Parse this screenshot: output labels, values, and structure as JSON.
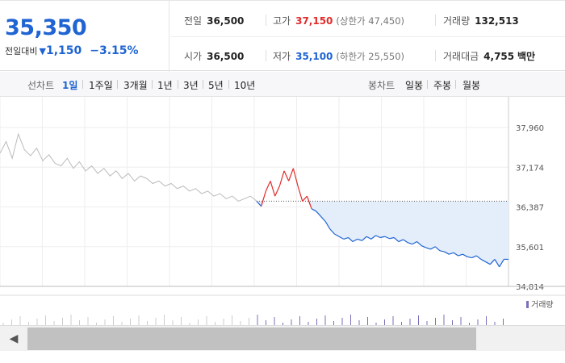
{
  "quote": {
    "price": "35,350",
    "change_label": "전일대비",
    "change_symbol": "▼",
    "change_amount": "1,150",
    "change_percent": "−3.15%"
  },
  "stats": {
    "prev_close": {
      "label": "전일",
      "value": "36,500"
    },
    "high": {
      "label": "고가",
      "value": "37,150",
      "sub": "(상한가 47,450)"
    },
    "volume": {
      "label": "거래량",
      "value": "132,513"
    },
    "open": {
      "label": "시가",
      "value": "36,500"
    },
    "low": {
      "label": "저가",
      "value": "35,100",
      "sub": "(하한가 25,550)"
    },
    "amount": {
      "label": "거래대금",
      "value": "4,755",
      "unit": "백만"
    }
  },
  "period_bar": {
    "line_label": "선차트",
    "line_periods": [
      "1일",
      "1주일",
      "3개월",
      "1년",
      "3년",
      "5년",
      "10년"
    ],
    "active": "1일",
    "candle_label": "봉차트",
    "candle_periods": [
      "일봉",
      "주봉",
      "월봉"
    ]
  },
  "chart_data": {
    "type": "line",
    "x_ticks": [],
    "y_ticks": [
      "37,960",
      "37,174",
      "36,387",
      "35,601",
      "34,814"
    ],
    "ylim": [
      34814,
      37960
    ],
    "reference_price": 36500,
    "grid": true,
    "volume_legend": "거래량",
    "series": [
      {
        "role": "previous day",
        "color": "#bbbbbb",
        "values": [
          37450,
          37680,
          37350,
          37830,
          37520,
          37400,
          37550,
          37300,
          37420,
          37250,
          37200,
          37350,
          37150,
          37280,
          37100,
          37200,
          37050,
          37150,
          37000,
          37100,
          36950,
          37050,
          36900,
          37000,
          36950,
          36850,
          36900,
          36800,
          36850,
          36750,
          36800,
          36700,
          36750,
          36650,
          36700,
          36600,
          36650,
          36550,
          36600,
          36500,
          36550,
          36600,
          36500
        ]
      },
      {
        "role": "today",
        "values": [
          36500,
          36400,
          36700,
          36900,
          36600,
          36800,
          37100,
          36900,
          37150,
          36800,
          36500,
          36600,
          36350,
          36300,
          36200,
          36100,
          35950,
          35850,
          35800,
          35750,
          35780,
          35700,
          35750,
          35720,
          35800,
          35750,
          35820,
          35780,
          35800,
          35760,
          35780,
          35700,
          35740,
          35680,
          35650,
          35700,
          35620,
          35580,
          35550,
          35600,
          35520,
          35500,
          35450,
          35480,
          35420,
          35450,
          35400,
          35380,
          35420,
          35350,
          35300,
          35250,
          35350,
          35200,
          35350,
          35350
        ]
      }
    ]
  },
  "colors": {
    "accent_blue": "#1f64d2",
    "up_red": "#e12b2b",
    "fill_blue": "#e4eefb"
  },
  "scrollbar": {
    "left_arrow": "◀"
  }
}
